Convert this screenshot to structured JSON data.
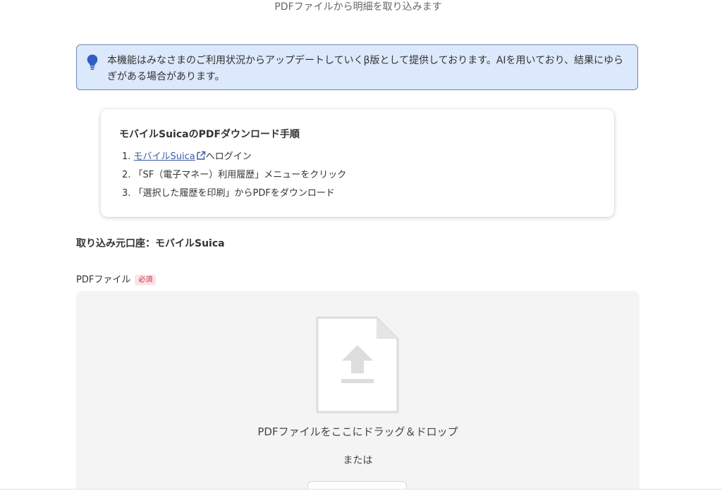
{
  "page": {
    "title": "PDFファイルから明細を取り込みます"
  },
  "notice": {
    "icon": "lightbulb-icon",
    "text": "本機能はみなさまのご利用状況からアップデートしていくβ版として提供しております。AIを用いており、結果にゆらぎがある場合があります。",
    "accent_color": "#2f5fc4"
  },
  "guide": {
    "title": "モバイルSuicaのPDFダウンロード手順",
    "steps": [
      {
        "number": "1.",
        "link_text": "モバイルSuica",
        "link_icon": "external-link-icon",
        "text": "へログイン"
      },
      {
        "number": "2.",
        "text": "「SF（電子マネー）利用履歴」メニューをクリック"
      },
      {
        "number": "3.",
        "text": "「選択した履歴を印刷」からPDFをダウンロード"
      }
    ]
  },
  "source": {
    "label": "取り込み元口座：モバイルSuica"
  },
  "pdf_field": {
    "label": "PDFファイル",
    "required_badge": "必須",
    "dropzone": {
      "icon": "file-upload-icon",
      "drop_text": "PDFファイルをここにドラッグ＆ドロップ",
      "or_text": "または"
    }
  }
}
